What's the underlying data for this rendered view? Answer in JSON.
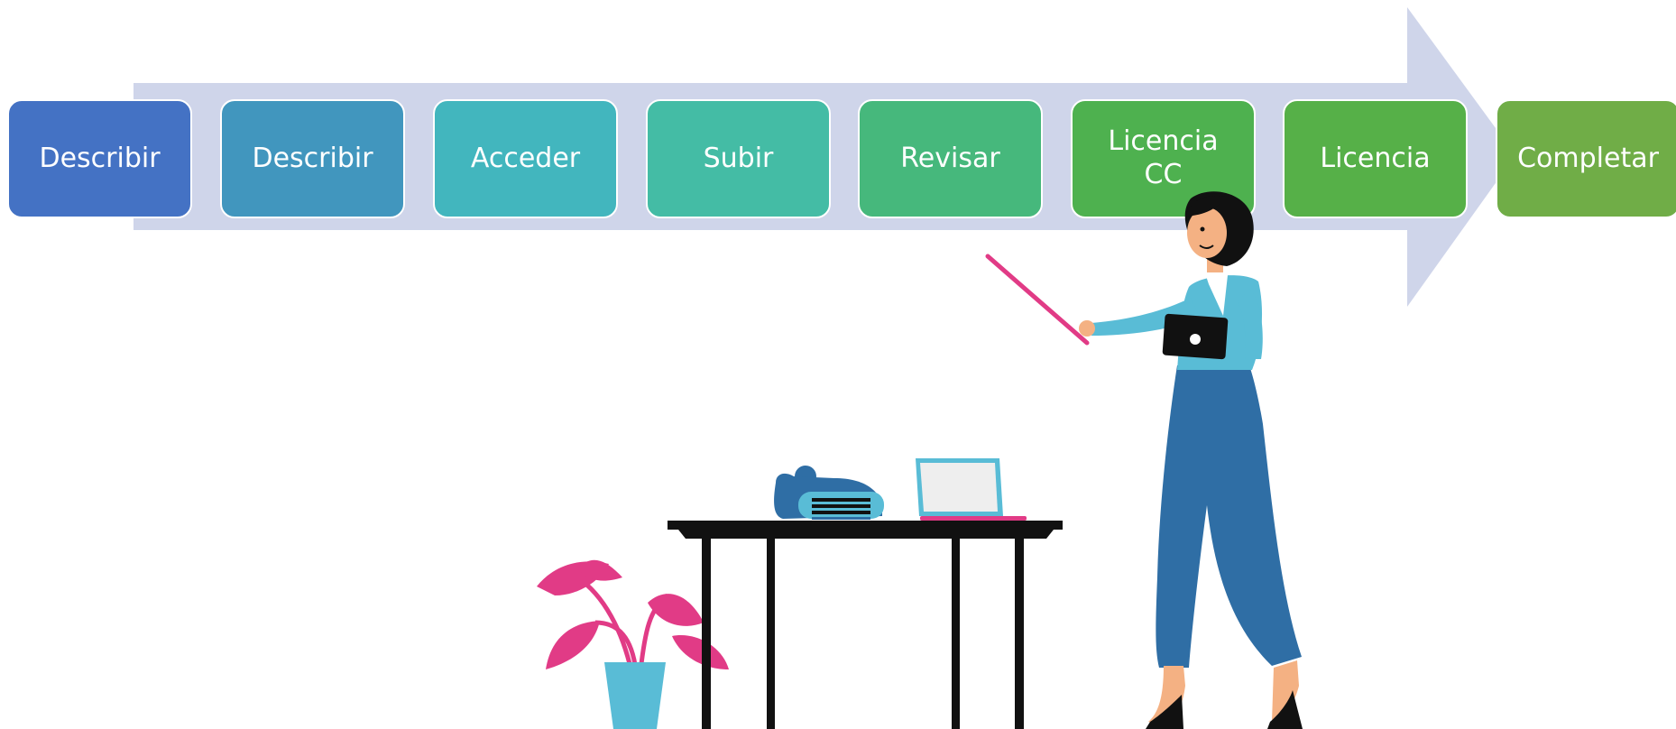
{
  "process": {
    "steps": [
      {
        "label": "Describir",
        "color": "#4472c4"
      },
      {
        "label": "Describir",
        "color": "#4196be"
      },
      {
        "label": "Acceder",
        "color": "#42b6be"
      },
      {
        "label": "Subir",
        "color": "#44bca5"
      },
      {
        "label": "Revisar",
        "color": "#46b87c"
      },
      {
        "label": "Licencia\nCC",
        "color": "#4eb14f"
      },
      {
        "label": "Licencia",
        "color": "#56b048"
      },
      {
        "label": "Completar",
        "color": "#70ad47"
      }
    ],
    "arrow_color": "#cfd5ea"
  }
}
